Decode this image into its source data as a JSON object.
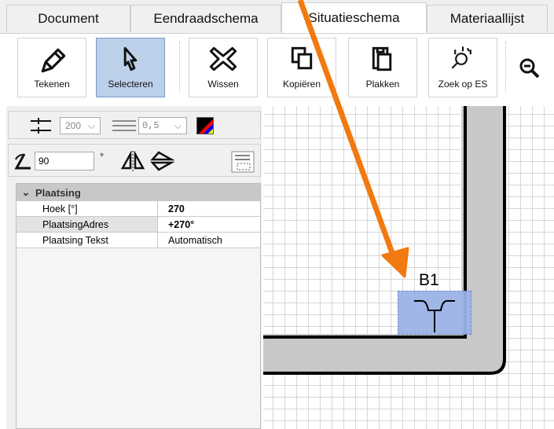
{
  "tabs": [
    {
      "label": "Document",
      "active": false
    },
    {
      "label": "Eendraadschema",
      "active": false
    },
    {
      "label": "Situatieschema",
      "active": true
    },
    {
      "label": "Materiaallijst",
      "active": false
    }
  ],
  "ribbon": {
    "buttons": [
      {
        "label": "Tekenen",
        "icon": "pencil-icon",
        "selected": false
      },
      {
        "label": "Selecteren",
        "icon": "cursor-icon",
        "selected": true
      },
      {
        "label": "Wissen",
        "icon": "x-icon",
        "selected": false
      },
      {
        "label": "Kopiëren",
        "icon": "copy-icon",
        "selected": false
      },
      {
        "label": "Plakken",
        "icon": "paste-icon",
        "selected": false
      },
      {
        "label": "Zoek op ES",
        "icon": "search-element-icon",
        "selected": false
      }
    ]
  },
  "toolbar": {
    "size_value": "200",
    "line_value": "0,5",
    "rotation_value": "90",
    "degree_symbol": "°"
  },
  "properties": {
    "group": "Plaatsing",
    "rows": [
      {
        "name": "Hoek [°]",
        "value": "270",
        "bold": true
      },
      {
        "name": "PlaatsingAdres",
        "value": "+270°",
        "bold": true
      },
      {
        "name": "Plaatsing Tekst",
        "value": "Automatisch",
        "bold": false
      }
    ]
  },
  "canvas": {
    "element_label": "B1",
    "selection_color": "#9bb3e6",
    "wall_color": "#c8c8c8"
  },
  "annotation": {
    "arrow_color": "#f07a10"
  }
}
